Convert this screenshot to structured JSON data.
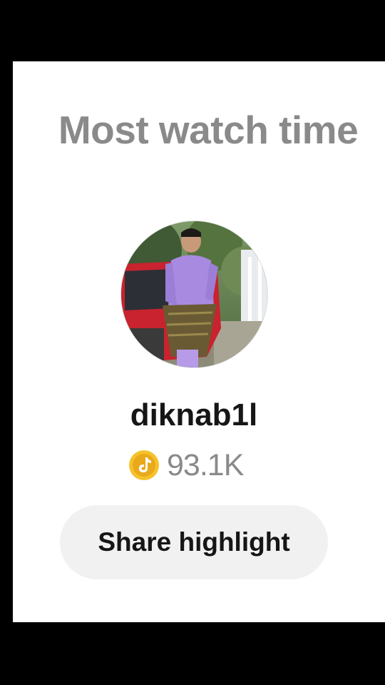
{
  "header": {
    "title": "Most watch time"
  },
  "profile": {
    "username": "diknab1l",
    "watch_time": "93.1K",
    "avatar_icon": "profile-photo",
    "coin_icon": "tiktok-coin-icon"
  },
  "actions": {
    "share_label": "Share highlight"
  },
  "colors": {
    "background": "#000000",
    "card": "#ffffff",
    "title": "#8a8a8a",
    "username": "#161616",
    "coin": "#f5c22c",
    "button": "#f1f1f2"
  }
}
